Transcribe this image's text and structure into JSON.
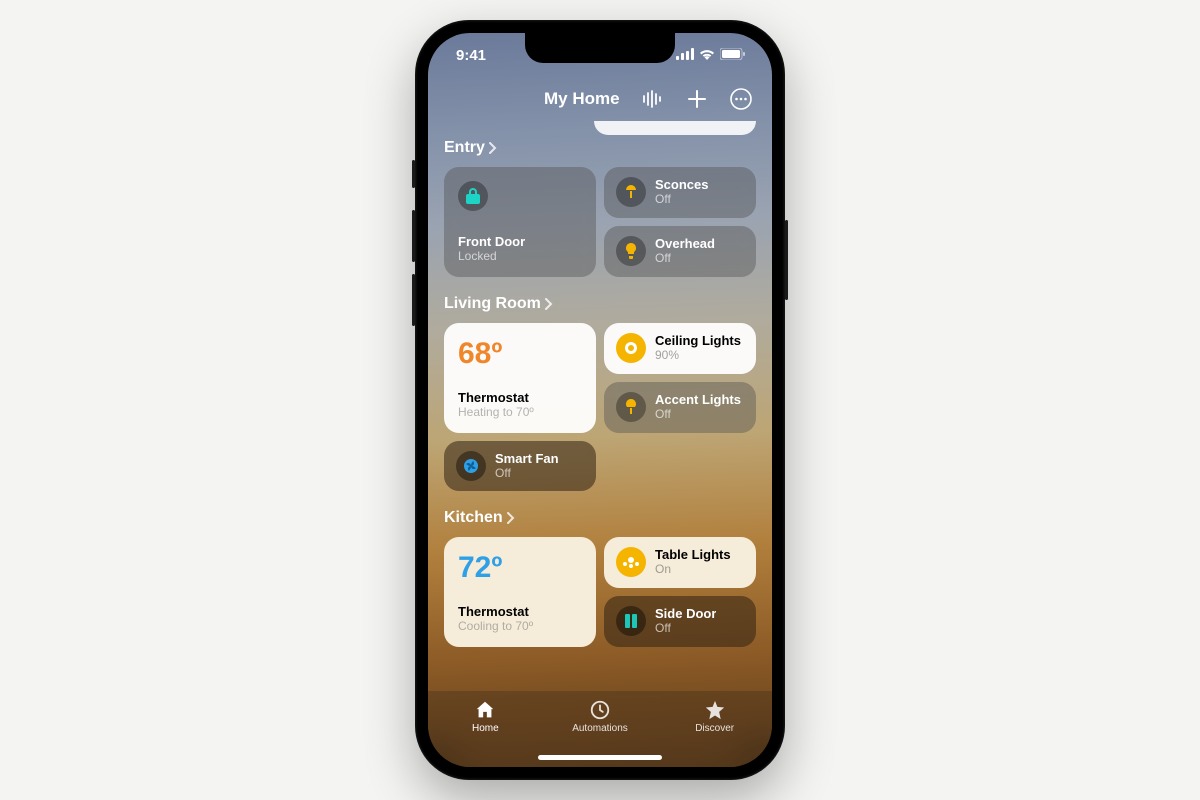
{
  "status": {
    "time": "9:41"
  },
  "nav": {
    "title": "My Home"
  },
  "rooms": {
    "entry": {
      "label": "Entry",
      "front_door": {
        "name": "Front Door",
        "status": "Locked"
      },
      "sconces": {
        "name": "Sconces",
        "status": "Off"
      },
      "overhead": {
        "name": "Overhead",
        "status": "Off"
      }
    },
    "living": {
      "label": "Living Room",
      "thermostat": {
        "temp": "68º",
        "name": "Thermostat",
        "status": "Heating to 70º"
      },
      "ceiling": {
        "name": "Ceiling Lights",
        "status": "90%"
      },
      "accent": {
        "name": "Accent Lights",
        "status": "Off"
      },
      "fan": {
        "name": "Smart Fan",
        "status": "Off"
      }
    },
    "kitchen": {
      "label": "Kitchen",
      "thermostat": {
        "temp": "72º",
        "name": "Thermostat",
        "status": "Cooling to 70º"
      },
      "table": {
        "name": "Table Lights",
        "status": "On"
      },
      "side_door": {
        "name": "Side Door",
        "status": "Off"
      }
    }
  },
  "tabs": {
    "home": "Home",
    "automations": "Automations",
    "discover": "Discover"
  }
}
